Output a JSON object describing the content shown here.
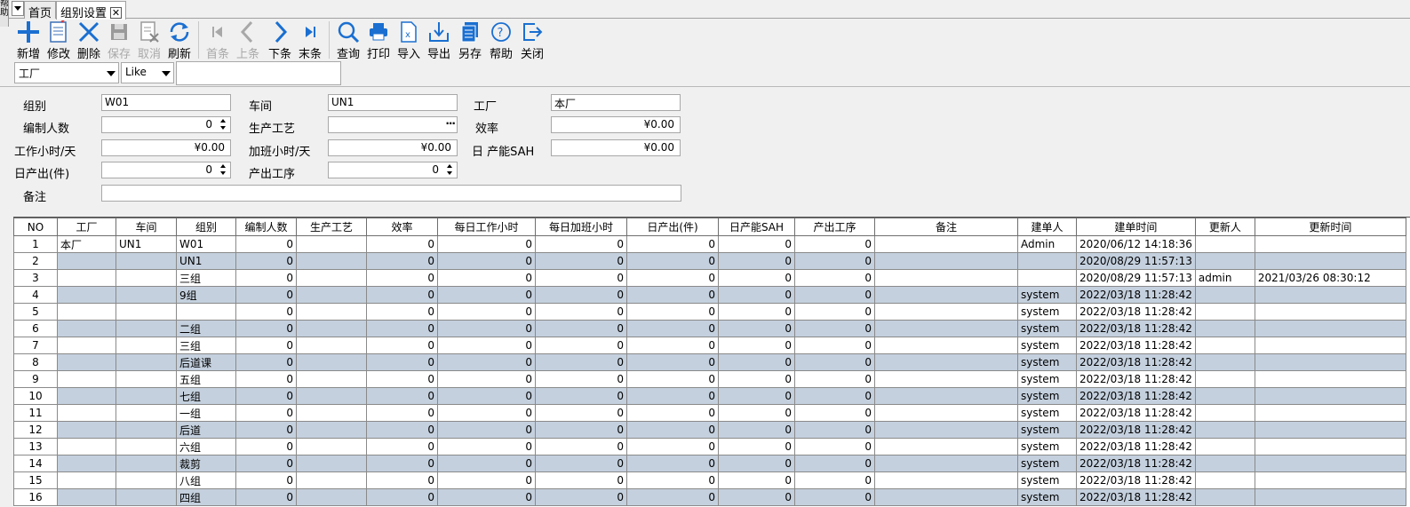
{
  "side_strip": {
    "text": "帮\n助"
  },
  "tabs": [
    {
      "label": "首页"
    },
    {
      "label": "组别设置"
    }
  ],
  "toolbar": [
    {
      "label": "新增",
      "icon": "plus-icon",
      "enabled": true
    },
    {
      "label": "修改",
      "icon": "edit-doc-icon",
      "enabled": true
    },
    {
      "label": "删除",
      "icon": "x-icon",
      "enabled": true
    },
    {
      "label": "保存",
      "icon": "save-icon",
      "enabled": false
    },
    {
      "label": "取消",
      "icon": "cancel-doc-icon",
      "enabled": false
    },
    {
      "label": "刷新",
      "icon": "refresh-icon",
      "enabled": true
    },
    {
      "label": "首条",
      "icon": "first-record-icon",
      "enabled": false
    },
    {
      "label": "上条",
      "icon": "prev-record-icon",
      "enabled": false
    },
    {
      "label": "下条",
      "icon": "next-record-icon",
      "enabled": true
    },
    {
      "label": "末条",
      "icon": "last-record-icon",
      "enabled": true
    },
    {
      "label": "查询",
      "icon": "search-icon",
      "enabled": true
    },
    {
      "label": "打印",
      "icon": "printer-icon",
      "enabled": true
    },
    {
      "label": "导入",
      "icon": "import-excel-icon",
      "enabled": true
    },
    {
      "label": "导出",
      "icon": "export-icon",
      "enabled": true
    },
    {
      "label": "另存",
      "icon": "save-as-icon",
      "enabled": true
    },
    {
      "label": "帮助",
      "icon": "help-icon",
      "enabled": true
    },
    {
      "label": "关闭",
      "icon": "close-icon",
      "enabled": true
    }
  ],
  "filter": {
    "field": "工厂",
    "operator": "Like",
    "value": ""
  },
  "form": {
    "group_label": "组别",
    "group_value": "W01",
    "workshop_label": "车间",
    "workshop_value": "UN1",
    "factory_label": "工厂",
    "factory_value": "本厂",
    "staff_label": "编制人数",
    "staff_value": "0",
    "process_label": "生产工艺",
    "process_value": "",
    "efficiency_label": "效率",
    "efficiency_value": "¥0.00",
    "work_hours_label": "工作小时/天",
    "work_hours_value": "¥0.00",
    "overtime_label": "加班小时/天",
    "overtime_value": "¥0.00",
    "daily_sah_label": "日 产能SAH",
    "daily_sah_value": "¥0.00",
    "daily_output_label": "日产出(件)",
    "daily_output_value": "0",
    "output_process_label": "产出工序",
    "output_process_value": "0",
    "remark_label": "备注",
    "remark_value": ""
  },
  "grid": {
    "columns": [
      "NO",
      "工厂",
      "车间",
      "组别",
      "编制人数",
      "生产工艺",
      "效率",
      "每日工作小时",
      "每日加班小时",
      "日产出(件)",
      "日产能SAH",
      "产出工序",
      "备注",
      "建单人",
      "建单时间",
      "更新人",
      "更新时间"
    ],
    "rows": [
      [
        "1",
        "本厂",
        "UN1",
        "W01",
        "0",
        "",
        "0",
        "0",
        "0",
        "0",
        "0",
        "0",
        "",
        "Admin",
        "2020/06/12 14:18:36",
        "",
        ""
      ],
      [
        "2",
        "",
        "",
        "UN1",
        "0",
        "",
        "0",
        "0",
        "0",
        "0",
        "0",
        "0",
        "",
        "",
        "2020/08/29 11:57:13",
        "",
        ""
      ],
      [
        "3",
        "",
        "",
        "三组",
        "0",
        "",
        "0",
        "0",
        "0",
        "0",
        "0",
        "0",
        "",
        "",
        "2020/08/29 11:57:13",
        "admin",
        "2021/03/26 08:30:12"
      ],
      [
        "4",
        "",
        "",
        "9组",
        "0",
        "",
        "0",
        "0",
        "0",
        "0",
        "0",
        "0",
        "",
        "system",
        "2022/03/18 11:28:42",
        "",
        ""
      ],
      [
        "5",
        "",
        "",
        "",
        "0",
        "",
        "0",
        "0",
        "0",
        "0",
        "0",
        "0",
        "",
        "system",
        "2022/03/18 11:28:42",
        "",
        ""
      ],
      [
        "6",
        "",
        "",
        "二组",
        "0",
        "",
        "0",
        "0",
        "0",
        "0",
        "0",
        "0",
        "",
        "system",
        "2022/03/18 11:28:42",
        "",
        ""
      ],
      [
        "7",
        "",
        "",
        "三组",
        "0",
        "",
        "0",
        "0",
        "0",
        "0",
        "0",
        "0",
        "",
        "system",
        "2022/03/18 11:28:42",
        "",
        ""
      ],
      [
        "8",
        "",
        "",
        "后道课",
        "0",
        "",
        "0",
        "0",
        "0",
        "0",
        "0",
        "0",
        "",
        "system",
        "2022/03/18 11:28:42",
        "",
        ""
      ],
      [
        "9",
        "",
        "",
        "五组",
        "0",
        "",
        "0",
        "0",
        "0",
        "0",
        "0",
        "0",
        "",
        "system",
        "2022/03/18 11:28:42",
        "",
        ""
      ],
      [
        "10",
        "",
        "",
        "七组",
        "0",
        "",
        "0",
        "0",
        "0",
        "0",
        "0",
        "0",
        "",
        "system",
        "2022/03/18 11:28:42",
        "",
        ""
      ],
      [
        "11",
        "",
        "",
        "一组",
        "0",
        "",
        "0",
        "0",
        "0",
        "0",
        "0",
        "0",
        "",
        "system",
        "2022/03/18 11:28:42",
        "",
        ""
      ],
      [
        "12",
        "",
        "",
        "后道",
        "0",
        "",
        "0",
        "0",
        "0",
        "0",
        "0",
        "0",
        "",
        "system",
        "2022/03/18 11:28:42",
        "",
        ""
      ],
      [
        "13",
        "",
        "",
        "六组",
        "0",
        "",
        "0",
        "0",
        "0",
        "0",
        "0",
        "0",
        "",
        "system",
        "2022/03/18 11:28:42",
        "",
        ""
      ],
      [
        "14",
        "",
        "",
        "裁剪",
        "0",
        "",
        "0",
        "0",
        "0",
        "0",
        "0",
        "0",
        "",
        "system",
        "2022/03/18 11:28:42",
        "",
        ""
      ],
      [
        "15",
        "",
        "",
        "八组",
        "0",
        "",
        "0",
        "0",
        "0",
        "0",
        "0",
        "0",
        "",
        "system",
        "2022/03/18 11:28:42",
        "",
        ""
      ],
      [
        "16",
        "",
        "",
        "四组",
        "0",
        "",
        "0",
        "0",
        "0",
        "0",
        "0",
        "0",
        "",
        "system",
        "2022/03/18 11:28:42",
        "",
        ""
      ]
    ]
  },
  "colors": {
    "accent": "#1a6fd1",
    "row_alt": "#c4d0de",
    "disabled_text": "#a8a8a8"
  }
}
